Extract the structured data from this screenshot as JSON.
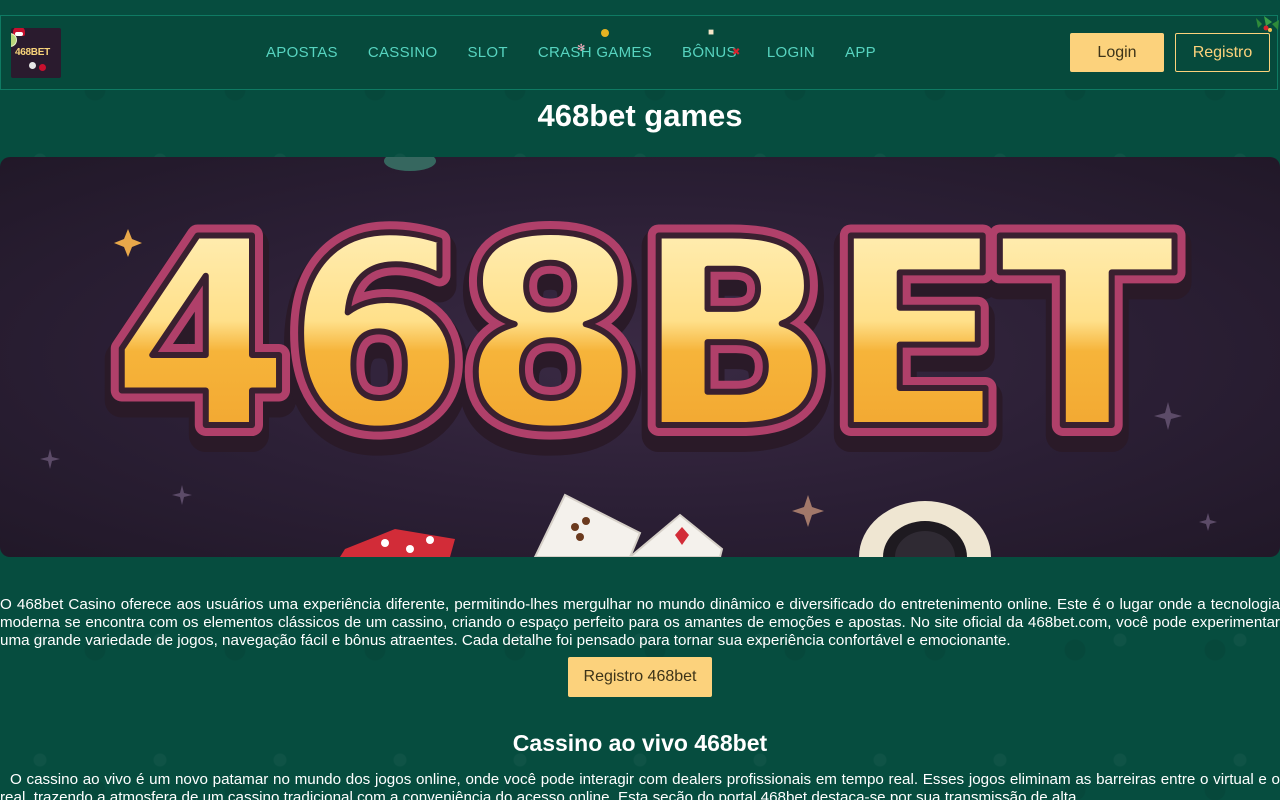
{
  "header": {
    "logo_text": "468BET",
    "nav": [
      {
        "label": "APOSTAS"
      },
      {
        "label": "CASSINO"
      },
      {
        "label": "SLOT"
      },
      {
        "label": "CRASH GAMES"
      },
      {
        "label": "BÔNUS"
      },
      {
        "label": "LOGIN"
      },
      {
        "label": "APP"
      }
    ],
    "login_label": "Login",
    "register_label": "Registro"
  },
  "main": {
    "title": "468bet games",
    "banner_text": "468BET",
    "intro": "O 468bet Casino oferece aos usuários uma experiência diferente, permitindo-lhes mergulhar no mundo dinâmico e diversificado do entretenimento online. Este é o lugar onde a tecnologia moderna se encontra com os elementos clássicos de um cassino, criando o espaço perfeito para os amantes de emoções e apostas. No site oficial da 468bet.com, você pode experimentar uma grande variedade de jogos, navegação fácil e bônus atraentes. Cada detalhe foi pensado para tornar sua experiência confortável e emocionante.",
    "cta_label": "Registro 468bet",
    "section_title": "Cassino ao vivo 468bet",
    "section_text": "O cassino ao vivo é um novo patamar no mundo dos jogos online, onde você pode interagir com dealers profissionais em tempo real. Esses jogos eliminam as barreiras entre o virtual e o real, trazendo a atmosfera de um cassino tradicional com a conveniência do acesso online. Esta seção do portal 468bet destaca-se por sua transmissão de alta"
  },
  "colors": {
    "background": "#064d3f",
    "nav_text": "#57d4c0",
    "accent": "#fcd27c",
    "banner_bg": "#2b1f35"
  }
}
